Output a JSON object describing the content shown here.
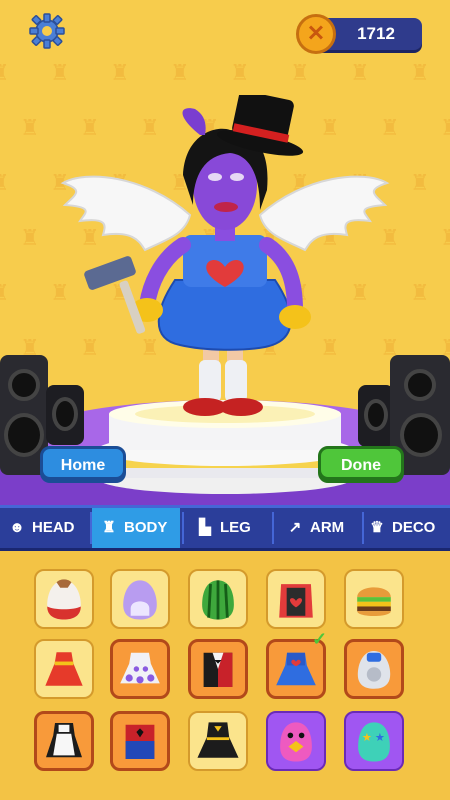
{
  "coins": "1712",
  "coin_symbol": "✕",
  "buttons": {
    "home": "Home",
    "done": "Done"
  },
  "tabs": [
    {
      "label": "HEAD",
      "icon": "head-icon"
    },
    {
      "label": "BODY",
      "icon": "shirt-icon",
      "active": true
    },
    {
      "label": "LEG",
      "icon": "boot-icon"
    },
    {
      "label": "ARM",
      "icon": "arm-icon"
    },
    {
      "label": "DECO",
      "icon": "crown-icon"
    }
  ],
  "outfits": [
    "white-red-egg-body",
    "purple-egg-body",
    "watermelon-body",
    "cape-heart-body",
    "burger-body",
    "red-dress-body",
    "white-purple-dress-body",
    "tuxedo-body",
    "blue-heart-dress-body",
    "astronaut-egg-body",
    "maid-body",
    "spider-suit-body",
    "black-gold-dress-body",
    "pink-bird-body",
    "teal-star-body"
  ],
  "equipped_outfit": "blue-heart-dress-body",
  "colors": {
    "background": "#f7cc4c",
    "tab_bar": "#2b3e9a",
    "tab_active": "#2f9ce6",
    "home": "#2d8de0",
    "done": "#4fc63a"
  }
}
